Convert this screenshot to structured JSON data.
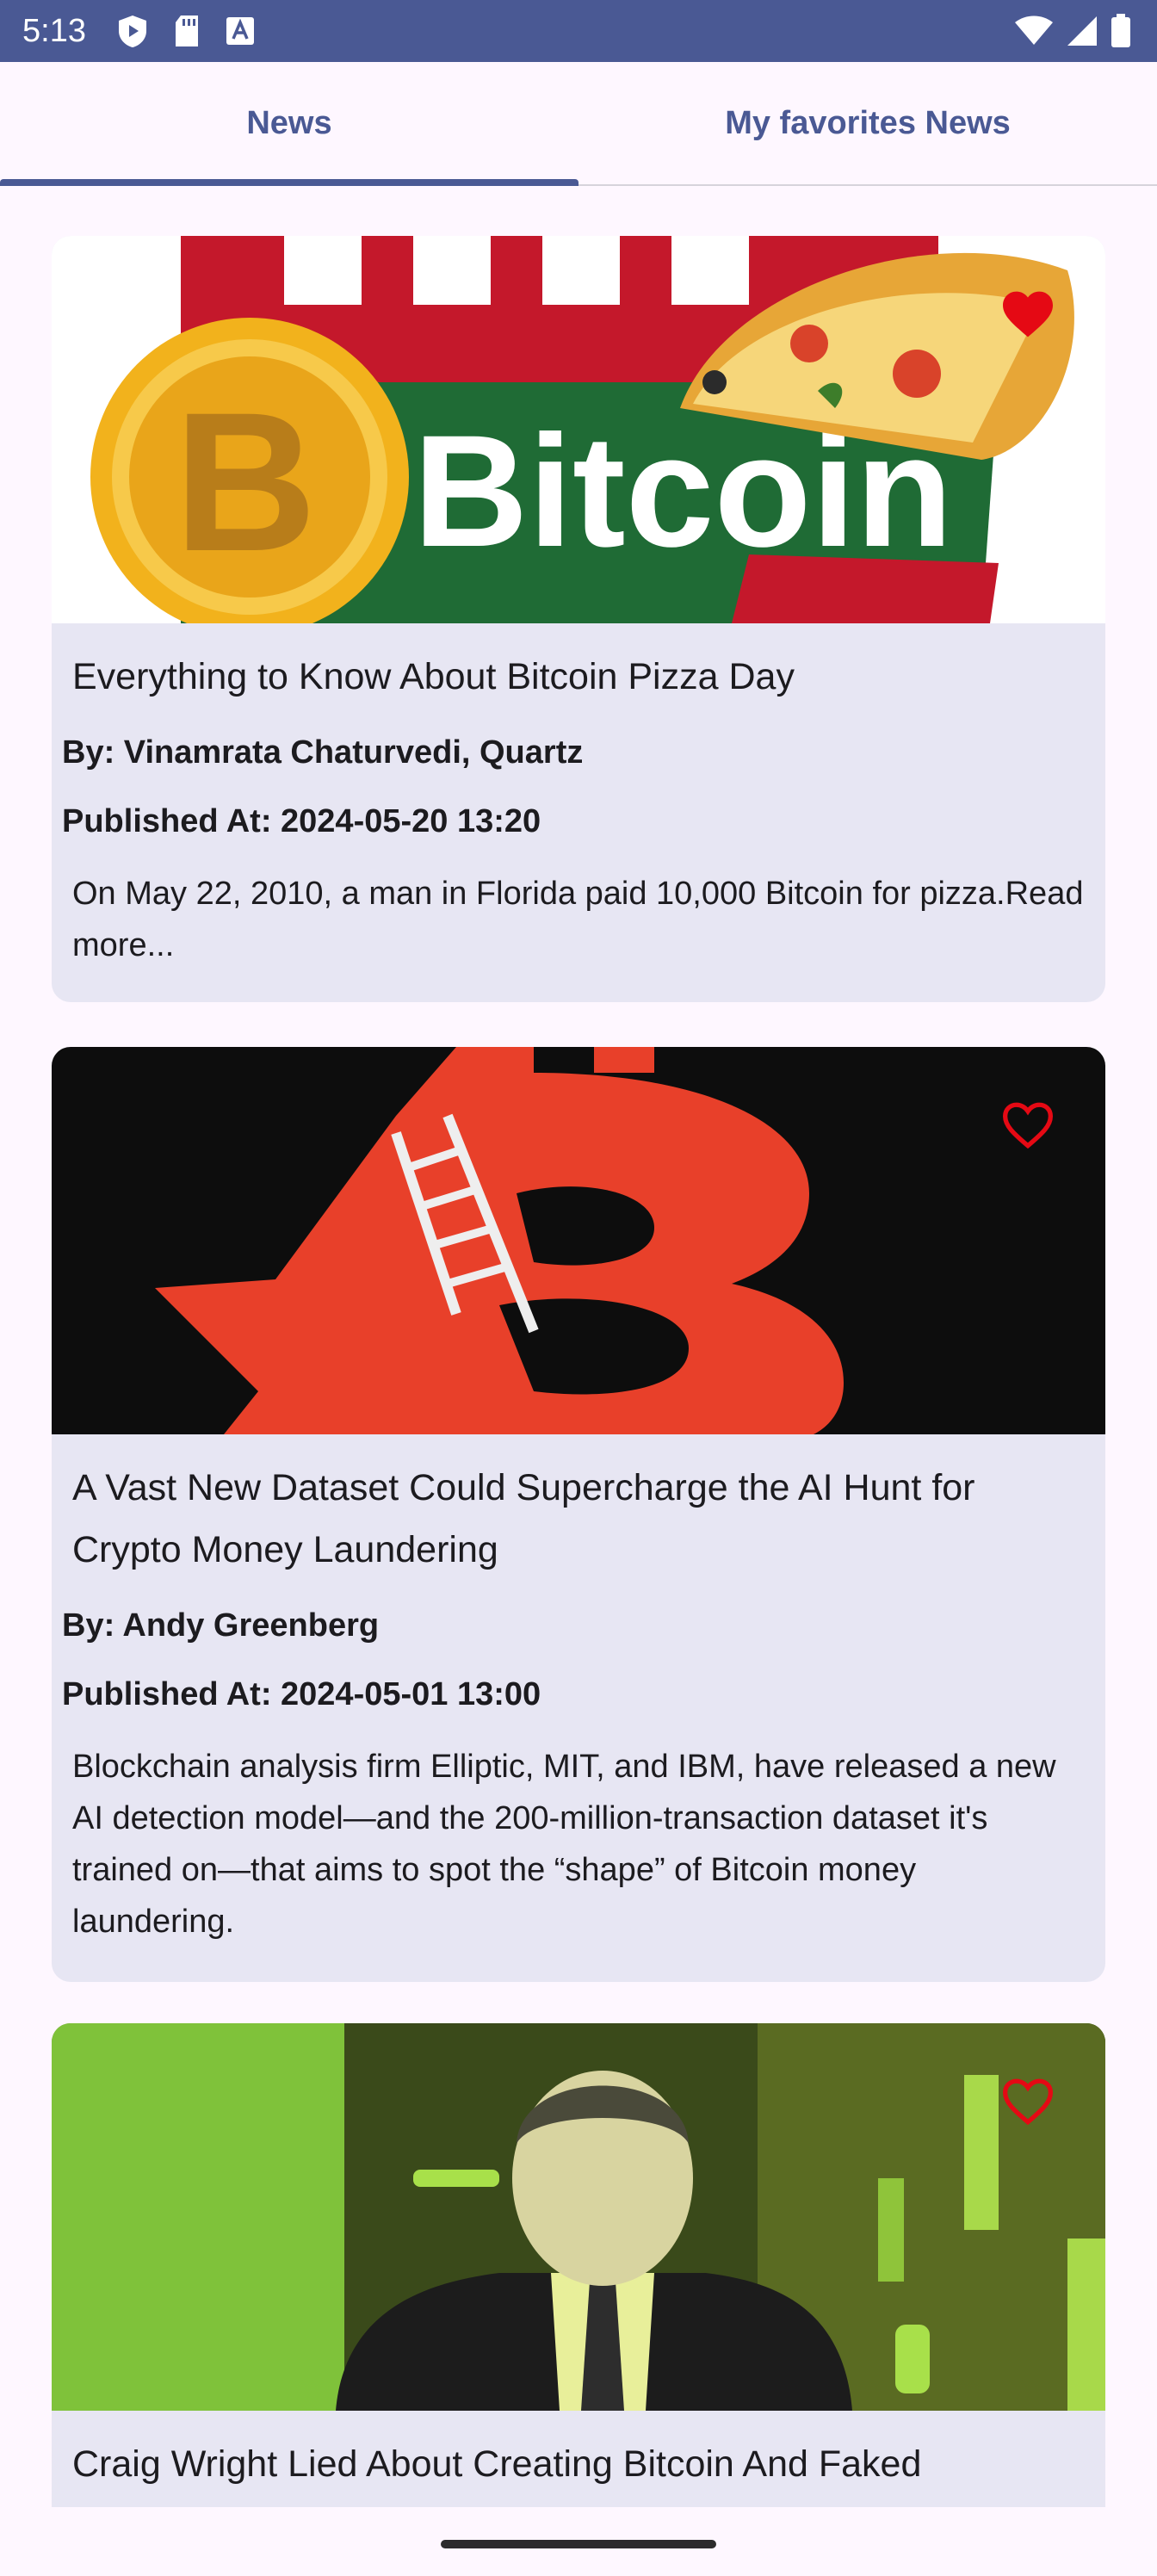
{
  "status_bar": {
    "time": "5:13",
    "icons_left": [
      "shield-play-icon",
      "sd-card-icon",
      "text-a-icon"
    ],
    "icons_right": [
      "wifi-icon",
      "cell-signal-icon",
      "battery-icon"
    ]
  },
  "tabs": [
    {
      "label": "News",
      "selected": true
    },
    {
      "label": "My favorites News",
      "selected": false
    }
  ],
  "colors": {
    "primary": "#4a5994",
    "card_bg": "#e7e6f3",
    "page_bg": "#fef7ff",
    "favorite_red": "#e50914"
  },
  "articles": [
    {
      "title": "Everything to Know About Bitcoin Pizza Day",
      "author": "By: Vinamrata Chaturvedi, Quartz",
      "published": "Published At: 2024-05-20 13:20",
      "description": "On May 22, 2010, a man in Florida paid 10,000 Bitcoin for pizza.Read more...",
      "favorite": true,
      "image_text": "Bitcoin"
    },
    {
      "title": "A Vast New Dataset Could Supercharge the AI Hunt for Crypto Money Laundering",
      "author": "By: Andy Greenberg",
      "published": "Published At: 2024-05-01 13:00",
      "description": "Blockchain analysis firm Elliptic, MIT, and IBM, have released a new AI detection model—and the 200-million-transaction dataset it's trained on—that aims to spot the “shape” of Bitcoin money laundering.",
      "favorite": false
    },
    {
      "title": "Craig Wright Lied About Creating Bitcoin And Faked",
      "favorite": false
    }
  ]
}
